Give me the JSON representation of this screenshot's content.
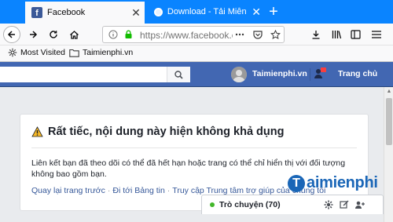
{
  "browser": {
    "tabs": [
      {
        "title": "Facebook",
        "favicon": "facebook-f-icon",
        "active": true
      },
      {
        "title": "Download - Tải Miễn Phí VN - Phần mềm miễn phí",
        "favicon": "download-site-icon",
        "active": false
      }
    ],
    "new_tab_symbol": "+",
    "close_symbol": "✕",
    "url": "https://www.facebook.com/",
    "bookmarks": [
      {
        "label": "Most Visited",
        "icon": "gear-icon"
      },
      {
        "label": "Taimienphi.vn",
        "icon": "folder-icon"
      }
    ],
    "accent_color": "#0a84ff"
  },
  "facebook": {
    "search_placeholder": "",
    "profile_name": "Taimienphi.vn",
    "home_label": "Trang chủ",
    "brand_color": "#4267b2"
  },
  "error_card": {
    "title": "Rất tiếc, nội dung này hiện không khả dụng",
    "message": "Liên kết bạn đã theo dõi có thể đã hết hạn hoặc trang có thể chỉ hiển thị với đối tượng không bao gồm bạn.",
    "links": [
      "Quay lại trang trước",
      "Đi tới Bảng tin",
      "Truy cập Trung tâm trợ giúp của chúng tôi"
    ],
    "link_separator": "·"
  },
  "chat": {
    "label": "Trò chuyện (70)",
    "status_color": "#42b72a"
  },
  "watermark": {
    "logo_letter": "T",
    "text": "aimienphi"
  }
}
